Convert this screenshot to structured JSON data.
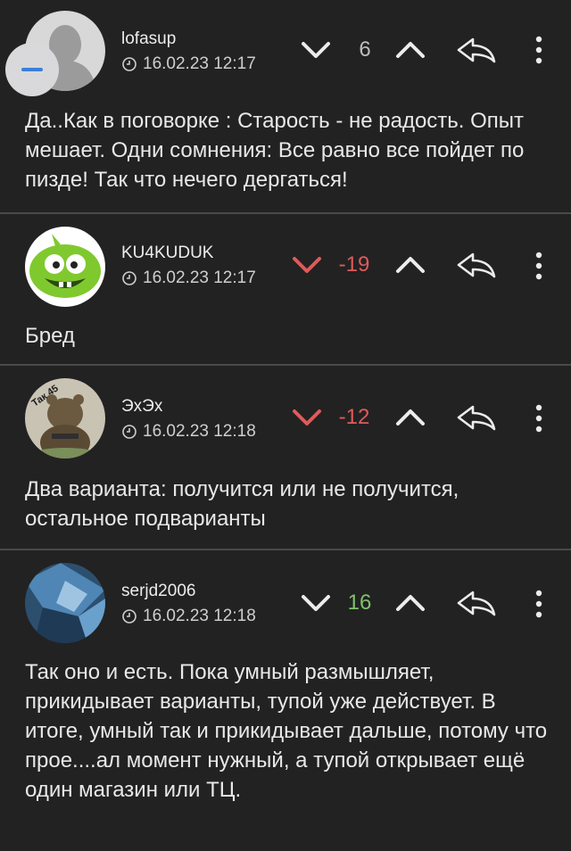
{
  "colors": {
    "background": "#222223",
    "negative": "#e05a5a",
    "positive": "#7fc26a",
    "neutral": "#bdbdbd",
    "divider": "#4a4a4c"
  },
  "comments": [
    {
      "author": "lofasup",
      "date": "16.02.23 12:17",
      "score": "6",
      "text": "Да..Как в поговорке : Старость - не радость. Опыт мешает. Одни сомнения: Все равно все пойдет по пизде! Так что нечего дергаться!",
      "avatar_icon": "default-user-avatar",
      "collapsed_button_icon": "minus-icon"
    },
    {
      "author": "KU4KUDUK",
      "date": "16.02.23 12:17",
      "score": "-19",
      "text": "Бред",
      "avatar_icon": "green-monster-avatar"
    },
    {
      "author": "ЭхЭх",
      "date": "16.02.23 12:18",
      "score": "-12",
      "text": "Два варианта: получится или не получится, остальное подварианты",
      "avatar_icon": "bear-illustration-avatar",
      "avatar_text": "Так 45"
    },
    {
      "author": "serjd2006",
      "date": "16.02.23 12:18",
      "score": "16",
      "text": "Так оно и есть. Пока умный размышляет, прикидывает варианты, тупой уже действует. В итоге, умный так и прикидывает дальше, потому что прое....ал момент нужный, а тупой открывает ещё один магазин или ТЦ.",
      "avatar_icon": "blue-abstract-avatar"
    }
  ]
}
